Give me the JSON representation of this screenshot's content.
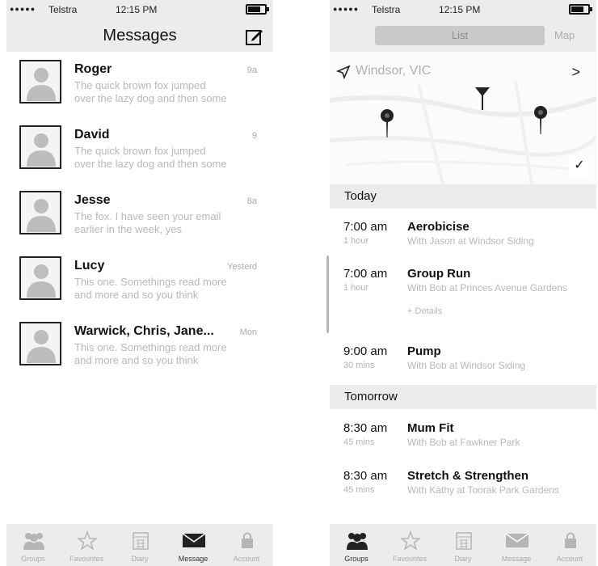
{
  "status": {
    "carrier": "Telstra",
    "time": "12:15 PM",
    "battery": 0.7
  },
  "messages_screen": {
    "title": "Messages",
    "conversations": [
      {
        "name": "Roger",
        "time": "9a",
        "preview": "The quick brown fox jumped over the lazy dog and then some"
      },
      {
        "name": "David",
        "time": "9",
        "preview": "The quick brown fox jumped over the lazy dog and then some"
      },
      {
        "name": "Jesse",
        "time": "8a",
        "preview": "The fox. I have seen your email earlier in the week, yes"
      },
      {
        "name": "Lucy",
        "time": "Yesterd",
        "preview": "This one. Somethings read more and more and so you think"
      },
      {
        "name": "Warwick, Chris, Jane...",
        "time": "Mon",
        "preview": "This one. Somethings read more and more and so you think"
      }
    ]
  },
  "groups_screen": {
    "segments": {
      "left": "List",
      "right": "Map"
    },
    "location": "Windsor, VIC",
    "sections": [
      {
        "title": "Today",
        "events": [
          {
            "time": "7:00 am",
            "duration": "1 hour",
            "title": "Aerobicise",
            "desc": "With Jason at Windsor Siding",
            "extra": ""
          },
          {
            "time": "7:00 am",
            "duration": "1 hour",
            "title": "Group Run",
            "desc": "With Bob at Princes Avenue Gardens",
            "extra": "+ Details"
          },
          {
            "time": "9:00 am",
            "duration": "30 mins",
            "title": "Pump",
            "desc": "With Bob at Windsor Siding",
            "extra": ""
          }
        ]
      },
      {
        "title": "Tomorrow",
        "events": [
          {
            "time": "8:30 am",
            "duration": "45 mins",
            "title": "Mum Fit",
            "desc": "With Bob at Fawkner Park",
            "extra": ""
          },
          {
            "time": "8:30 am",
            "duration": "45 mins",
            "title": "Stretch & Strengthen",
            "desc": "With Kathy at Toorak Park Gardens",
            "extra": ""
          }
        ]
      }
    ]
  },
  "left_tabbar": {
    "tabs": [
      {
        "icon": "groups-icon",
        "label": "Groups"
      },
      {
        "icon": "star-icon",
        "label": "Favourites"
      },
      {
        "icon": "calendar-icon",
        "label": "Diary"
      },
      {
        "icon": "envelope-icon",
        "label": "Message"
      },
      {
        "icon": "lock-icon",
        "label": "Account"
      }
    ],
    "active": 3
  },
  "right_tabbar": {
    "tabs": [
      {
        "icon": "groups-icon",
        "label": "Groups"
      },
      {
        "icon": "star-icon",
        "label": "Favourites"
      },
      {
        "icon": "calendar-icon",
        "label": "Diary"
      },
      {
        "icon": "envelope-icon",
        "label": "Message"
      },
      {
        "icon": "lock-icon",
        "label": "Account"
      }
    ],
    "active": 0
  }
}
